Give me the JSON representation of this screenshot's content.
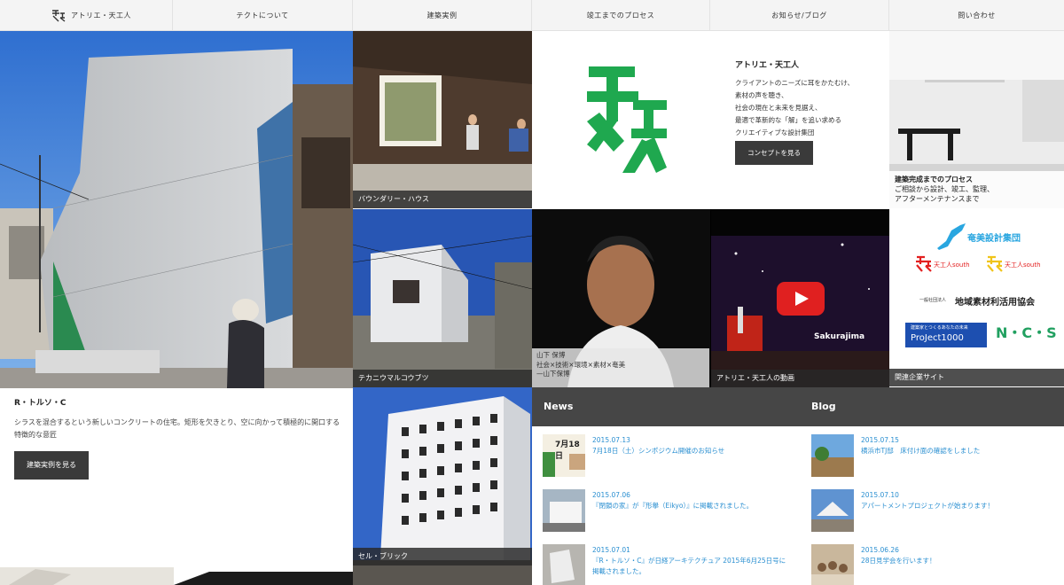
{
  "nav": {
    "logo_label": "アトリエ・天工人",
    "items": [
      "テクトについて",
      "建築実例",
      "竣工までのプロセス",
      "お知らせ/ブログ",
      "問い合わせ"
    ]
  },
  "hero": {
    "title": "R・トルソ・C",
    "desc": "シラスを混合するという新しいコンクリートの住宅。矩形を欠きとり、空に向かって積極的に開口する特徴的な意匠",
    "button": "建築実例を見る"
  },
  "tiles": {
    "boundary": "バウンダリー・ハウス",
    "tekani": "テカニウマルコウブツ",
    "cell": "セル・ブリック"
  },
  "concept": {
    "title": "アトリエ・天工人",
    "lines": [
      "クライアントのニーズに耳をかたむけ、",
      "素材の声を聴き、",
      "社会の現在と未来を見据え、",
      "最適で革新的な「解」を追い求める",
      "クリエイティブな設計集団"
    ],
    "button": "コンセプトを見る"
  },
  "process": {
    "title": "建築完成までのプロセス",
    "lines": [
      "ご相談から設計、竣工、監理、",
      "アフターメンテナンスまで"
    ]
  },
  "video": {
    "person_lines": [
      "山下 保博",
      "社会×技術×環境×素材×奄美",
      "—山下保博"
    ],
    "caption": "アトリエ・天工人の動画",
    "stage_text": "Sakurajima"
  },
  "partners": {
    "amami": "奄美設計集団",
    "south": "天工人south",
    "south2": "天工人south",
    "kyokai": "地域素材利活用協会",
    "kyokai_small": "一般社団法人",
    "project_tagline": "建築家とつくるあなたの未来",
    "project": "ProJect1000",
    "ncs": "N・C・S",
    "caption": "関連企業サイト"
  },
  "news": {
    "heading": "News",
    "items": [
      {
        "date": "2015.07.13",
        "title": "7月18日（土）シンポジウム開催のお知らせ",
        "thumb_text": "7月18日"
      },
      {
        "date": "2015.07.06",
        "title": "『閉鎖の家』が『形擧（Eikyo）』に掲載されました。"
      },
      {
        "date": "2015.07.01",
        "title": "『R・トルソ・C』が日経アーキテクチュア 2015年6月25日号に掲載されました。"
      }
    ]
  },
  "blog": {
    "heading": "Blog",
    "items": [
      {
        "date": "2015.07.15",
        "title": "横浜市TJ邸　床付け面の確認をしました"
      },
      {
        "date": "2015.07.10",
        "title": "アパートメントプロジェクトが始まります！"
      },
      {
        "date": "2015.06.26",
        "title": "28日見学会を行います！"
      }
    ]
  },
  "colors": {
    "brand_green": "#1fa84f",
    "link_blue": "#2a8fd1",
    "nav_bg": "#f4f4f4",
    "dark": "#3a3a3a"
  }
}
